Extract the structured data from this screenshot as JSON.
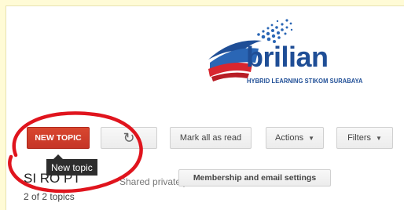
{
  "logo": {
    "word": "brilian",
    "tagline": "HYBRID LEARNING STIKOM SURABAYA"
  },
  "toolbar": {
    "new_topic_label": "NEW TOPIC",
    "refresh_icon": "refresh-icon",
    "mark_all_read_label": "Mark all as read",
    "actions_label": "Actions",
    "filters_label": "Filters"
  },
  "tooltip": {
    "text": "New topic"
  },
  "group": {
    "name": "SI RO PT",
    "sharing": "Shared privately",
    "membership_label": "Membership and email settings",
    "topic_count": "2 of 2 topics"
  },
  "colors": {
    "page_background": "#fffbd6",
    "new_topic_button": "#d13f2c",
    "annotation_circle": "#e0141d",
    "logo_blue": "#1f4e96",
    "logo_red": "#d8262f"
  }
}
